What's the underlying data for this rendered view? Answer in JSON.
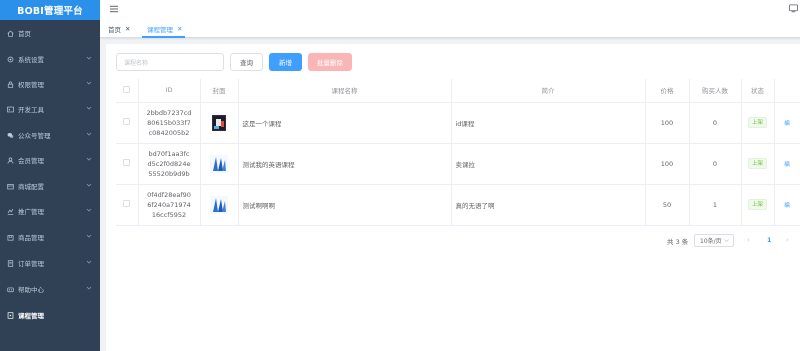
{
  "app": {
    "title": "BOBI管理平台"
  },
  "sidebar": {
    "items": [
      {
        "label": "首页",
        "icon": "home-icon",
        "has_arrow": false,
        "active": false
      },
      {
        "label": "系统设置",
        "icon": "gear-icon",
        "has_arrow": true,
        "active": false
      },
      {
        "label": "权限管理",
        "icon": "lock-icon",
        "has_arrow": true,
        "active": false
      },
      {
        "label": "开发工具",
        "icon": "terminal-icon",
        "has_arrow": true,
        "active": false
      },
      {
        "label": "公众号管理",
        "icon": "wechat-icon",
        "has_arrow": true,
        "active": false
      },
      {
        "label": "会员管理",
        "icon": "user-icon",
        "has_arrow": true,
        "active": false
      },
      {
        "label": "商城配置",
        "icon": "shop-icon",
        "has_arrow": true,
        "active": false
      },
      {
        "label": "推广管理",
        "icon": "promotion-icon",
        "has_arrow": true,
        "active": false
      },
      {
        "label": "商品管理",
        "icon": "box-icon",
        "has_arrow": true,
        "active": false
      },
      {
        "label": "订单管理",
        "icon": "order-icon",
        "has_arrow": true,
        "active": false
      },
      {
        "label": "帮助中心",
        "icon": "help-icon",
        "has_arrow": true,
        "active": false
      },
      {
        "label": "课程管理",
        "icon": "course-icon",
        "has_arrow": false,
        "active": true
      }
    ]
  },
  "tabs": [
    {
      "label": "首页",
      "close": "✕"
    },
    {
      "label": "课程管理",
      "close": "✕"
    }
  ],
  "toolbar": {
    "search_placeholder": "课程名称",
    "query_label": "查询",
    "add_label": "新增",
    "batch_delete_label": "批量删除"
  },
  "table": {
    "headers": [
      "",
      "ID",
      "封面",
      "课程名称",
      "简介",
      "价格",
      "购买人数",
      "状态",
      ""
    ],
    "rows": [
      {
        "id": "2bbdb7237cd80615b033f7c0842005b2",
        "name": "这是一个课程",
        "intro": "id课程",
        "price": "100",
        "buyers": "0",
        "status": "上架",
        "action": "编"
      },
      {
        "id": "bd70f1aa3fcd5c2f0d824e55520b9d9b",
        "name": "测试我的英语课程",
        "intro": "卖课拉",
        "price": "100",
        "buyers": "0",
        "status": "上架",
        "action": "编"
      },
      {
        "id": "0f4df28eaf906f240a7197416ccf5952",
        "name": "测试啊啊啊",
        "intro": "真的无语了啊",
        "price": "50",
        "buyers": "1",
        "status": "上架",
        "action": "编"
      }
    ]
  },
  "pagination": {
    "total_text": "共 3 条",
    "page_size_text": "10条/页",
    "current_page": "1",
    "prev": "‹",
    "next": "›"
  },
  "colors": {
    "sidebar_bg": "#304156",
    "logo_bg": "#2b90e9",
    "primary": "#409eff",
    "danger_light": "#fab6b6",
    "success": "#67c23a"
  }
}
